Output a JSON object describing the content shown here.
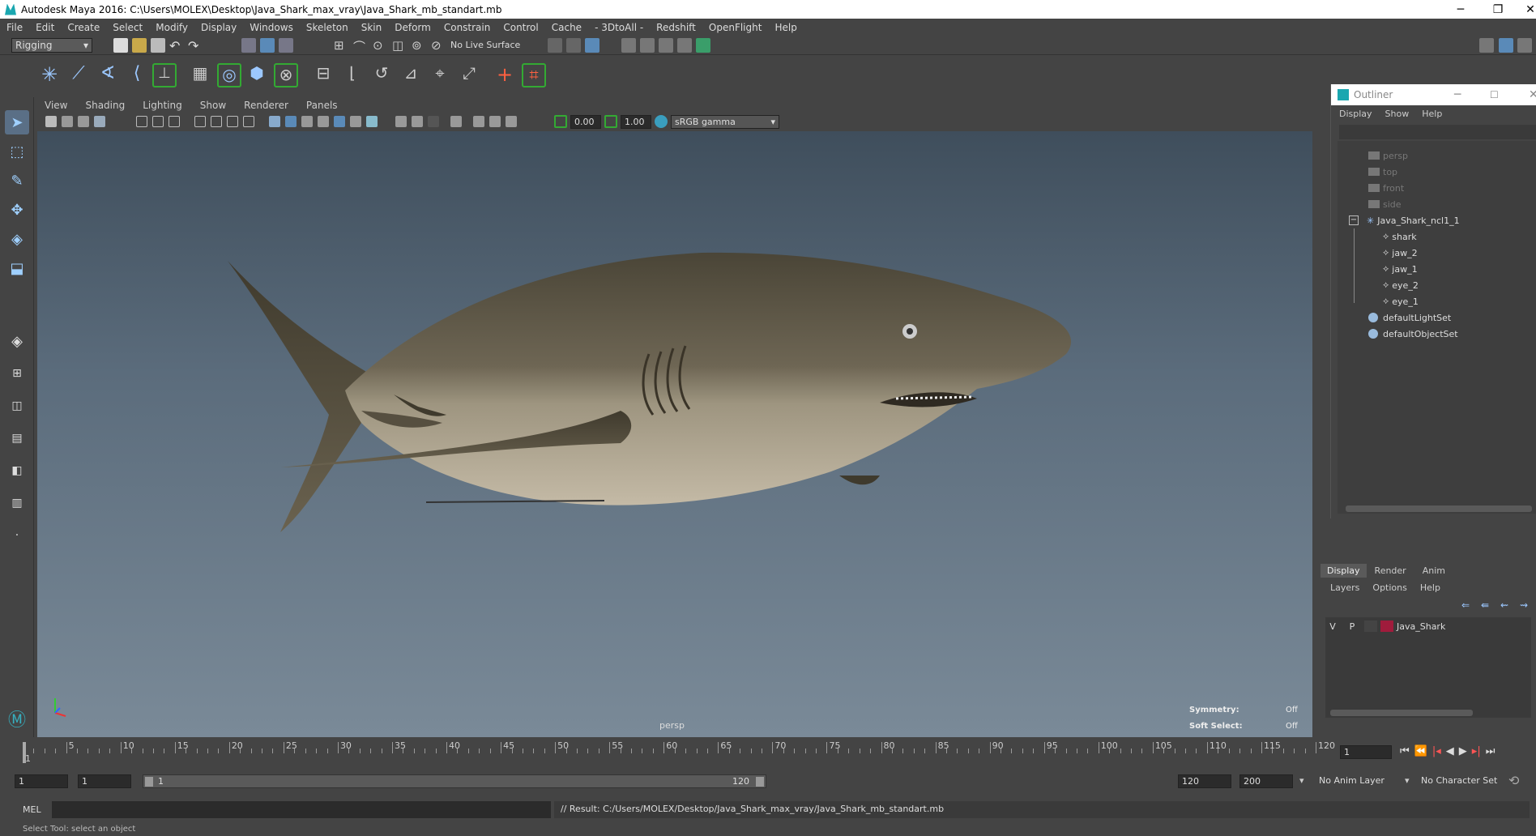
{
  "window": {
    "title": "Autodesk Maya 2016: C:\\Users\\MOLEX\\Desktop\\Java_Shark_max_vray\\Java_Shark_mb_standart.mb",
    "minimize": "─",
    "restore": "❐",
    "close": "✕"
  },
  "menubar": [
    "File",
    "Edit",
    "Create",
    "Select",
    "Modify",
    "Display",
    "Windows",
    "Skeleton",
    "Skin",
    "Deform",
    "Constrain",
    "Control",
    "Cache",
    "- 3DtoAll -",
    "Redshift",
    "OpenFlight",
    "Help"
  ],
  "statusline": {
    "mode": "Rigging",
    "live_surface": "No Live Surface"
  },
  "viewport": {
    "menu": [
      "View",
      "Shading",
      "Lighting",
      "Show",
      "Renderer",
      "Panels"
    ],
    "exposure": "0.00",
    "gamma": "1.00",
    "colorspace": "sRGB gamma",
    "camera": "persp",
    "symmetry_label": "Symmetry:",
    "symmetry_value": "Off",
    "soft_select_label": "Soft Select:",
    "soft_select_value": "Off"
  },
  "outliner": {
    "title": "Outliner",
    "menu": [
      "Display",
      "Show",
      "Help"
    ],
    "items": [
      {
        "label": "persp",
        "type": "camera",
        "dim": true
      },
      {
        "label": "top",
        "type": "camera",
        "dim": true
      },
      {
        "label": "front",
        "type": "camera",
        "dim": true
      },
      {
        "label": "side",
        "type": "camera",
        "dim": true
      },
      {
        "label": "Java_Shark_ncl1_1",
        "type": "group",
        "dim": false
      },
      {
        "label": "shark",
        "type": "mesh",
        "dim": false
      },
      {
        "label": "jaw_2",
        "type": "mesh",
        "dim": false
      },
      {
        "label": "jaw_1",
        "type": "mesh",
        "dim": false
      },
      {
        "label": "eye_2",
        "type": "mesh",
        "dim": false
      },
      {
        "label": "eye_1",
        "type": "mesh",
        "dim": false
      },
      {
        "label": "defaultLightSet",
        "type": "set",
        "dim": false
      },
      {
        "label": "defaultObjectSet",
        "type": "set",
        "dim": false
      }
    ],
    "expand_symbol": "−"
  },
  "layers": {
    "tabs": [
      "Display",
      "Render",
      "Anim"
    ],
    "menu": [
      "Layers",
      "Options",
      "Help"
    ],
    "layer": {
      "v": "V",
      "p": "P",
      "name": "Java_Shark",
      "color": "#a01c3c"
    }
  },
  "timeline": {
    "ticks": [
      "1",
      "5",
      "10",
      "15",
      "20",
      "25",
      "30",
      "35",
      "40",
      "45",
      "50",
      "55",
      "60",
      "65",
      "70",
      "75",
      "80",
      "85",
      "90",
      "95",
      "100",
      "105",
      "110",
      "115",
      "120"
    ],
    "current": "1"
  },
  "range": {
    "start": "1",
    "start2": "1",
    "slider_start": "1",
    "slider_end": "120",
    "end": "120",
    "end2": "200",
    "anim_layer": "No Anim Layer",
    "char_set": "No Character Set"
  },
  "cmdline": {
    "label": "MEL",
    "result": "// Result: C:/Users/MOLEX/Desktop/Java_Shark_max_vray/Java_Shark_mb_standart.mb"
  },
  "helpline": "Select Tool: select an object"
}
